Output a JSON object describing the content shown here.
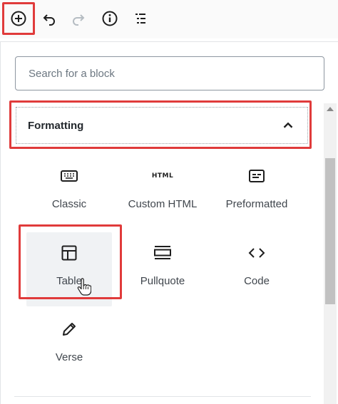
{
  "toolbar": {
    "add_block": "add-block",
    "undo": "undo",
    "redo": "redo",
    "info": "info",
    "outline": "block-navigation"
  },
  "search": {
    "placeholder": "Search for a block",
    "value": ""
  },
  "section": {
    "title": "Formatting",
    "expanded": true
  },
  "blocks": [
    {
      "label": "Classic",
      "icon": "keyboard-icon"
    },
    {
      "label": "Custom HTML",
      "icon": "html-icon",
      "icon_text": "HTML"
    },
    {
      "label": "Preformatted",
      "icon": "preformatted-icon"
    },
    {
      "label": "Table",
      "icon": "table-icon",
      "selected": true
    },
    {
      "label": "Pullquote",
      "icon": "pullquote-icon"
    },
    {
      "label": "Code",
      "icon": "code-icon"
    },
    {
      "label": "Verse",
      "icon": "pencil-icon"
    }
  ],
  "colors": {
    "highlight": "#e03b3b",
    "text": "#40464d",
    "active_bg": "#f0f2f4"
  }
}
